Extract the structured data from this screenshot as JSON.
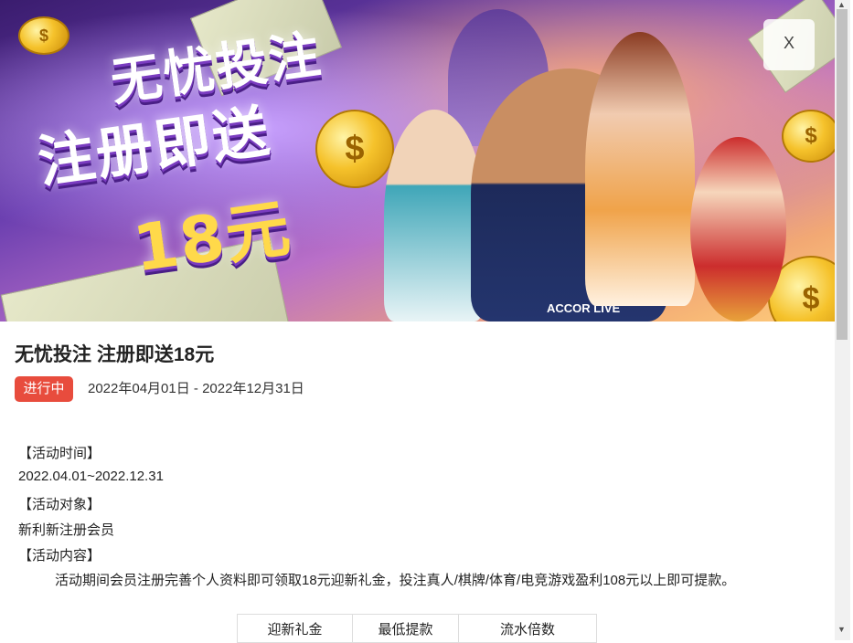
{
  "banner": {
    "slogan_line1": "无忧投注",
    "slogan_line2": "注册即送",
    "slogan_amount": "18元",
    "coin_symbol": "$",
    "jersey_text": "ACCOR LIVE",
    "colors": {
      "primary": "#6b3fb0",
      "accent": "#f5c22b"
    }
  },
  "close_button": {
    "label": "X"
  },
  "promo": {
    "title": "无忧投注 注册即送18元",
    "status": "进行中",
    "date_range": "2022年04月01日 - 2022年12月31日",
    "status_color": "#e84c3d"
  },
  "details": {
    "time_heading": "【活动时间】",
    "time_value": "2022.04.01~2022.12.31",
    "target_heading": "【活动对象】",
    "target_value": "新利新注册会员",
    "content_heading": "【活动内容】",
    "content_value": "活动期间会员注册完善个人资料即可领取18元迎新礼金，投注真人/棋牌/体育/电竞游戏盈利108元以上即可提款。"
  },
  "reward_table": {
    "headers": [
      "迎新礼金",
      "最低提款",
      "流水倍数"
    ]
  }
}
